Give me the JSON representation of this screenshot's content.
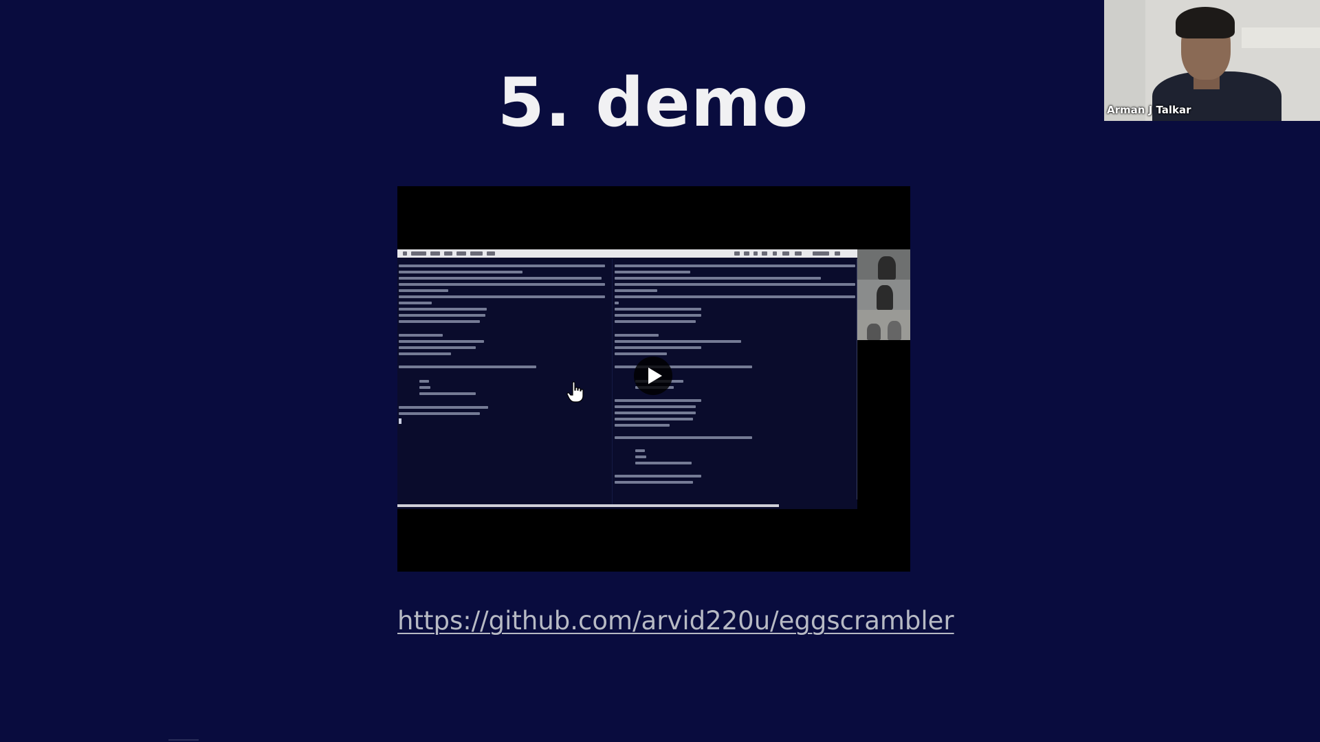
{
  "slide": {
    "title": "5. demo",
    "link_text": "https://github.com/arvid220u/eggscrambler"
  },
  "video": {
    "play_icon": "play-icon",
    "cursor_icon": "hand-pointer-icon"
  },
  "participant": {
    "name": "Arman J Talkar"
  },
  "colors": {
    "background": "#090c3e",
    "title": "#f1f1f3",
    "link": "#b7bac4",
    "video_frame": "#000000"
  }
}
